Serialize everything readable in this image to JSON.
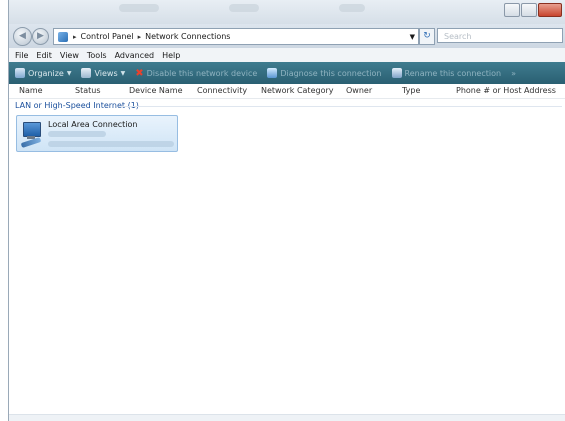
{
  "address": {
    "crumbs": [
      "Control Panel",
      "Network Connections"
    ],
    "search_placeholder": "Search"
  },
  "menu": [
    "File",
    "Edit",
    "View",
    "Tools",
    "Advanced",
    "Help"
  ],
  "toolbar": {
    "organize": "Organize",
    "views": "Views",
    "disable": "Disable this network device",
    "diagnose": "Diagnose this connection",
    "rename": "Rename this connection",
    "more": "»"
  },
  "columns": [
    "Name",
    "Status",
    "Device Name",
    "Connectivity",
    "Network Category",
    "Owner",
    "Type",
    "Phone # or Host Address"
  ],
  "group": {
    "label": "LAN or High-Speed Internet (1)"
  },
  "connections": [
    {
      "name": "Local Area Connection"
    }
  ],
  "colors": {
    "toolbar_bg": "#3f7c8f",
    "accent": "#1a4f9c",
    "selected_item": "#cfe4f6",
    "disable_icon": "#e8412c"
  },
  "icons": {
    "back": "back-arrow-icon",
    "forward": "forward-arrow-icon",
    "control_panel": "control-panel-icon",
    "refresh": "refresh-icon",
    "network_adapter": "network-adapter-icon"
  }
}
